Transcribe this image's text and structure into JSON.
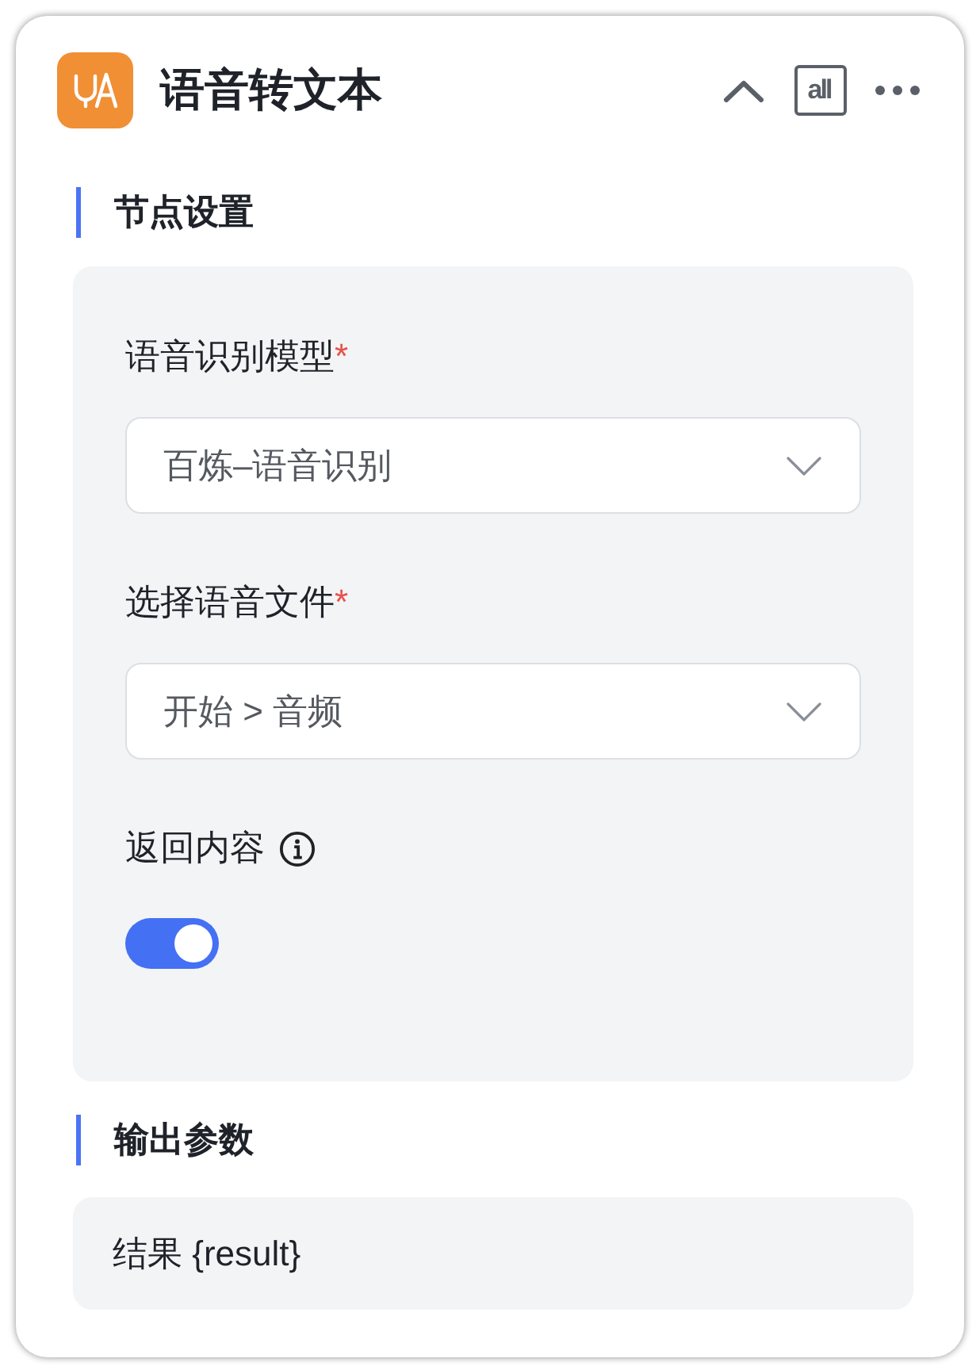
{
  "node": {
    "title": "语音转文本",
    "header_actions": [
      {
        "kind": "collapse"
      },
      {
        "kind": "text",
        "label": "all"
      },
      {
        "kind": "more"
      }
    ]
  },
  "sections": [
    {
      "kind": "settings",
      "title": "节点设置",
      "fields": [
        {
          "kind": "select",
          "label": "语音识别模型",
          "required_mark": "*",
          "value": "百炼–语音识别"
        },
        {
          "kind": "select",
          "label": "选择语音文件",
          "required_mark": "*",
          "value": "开始 > 音频"
        },
        {
          "kind": "switch",
          "label": "返回内容",
          "has_info": true,
          "on": true
        }
      ]
    },
    {
      "kind": "outputs",
      "title": "输出参数",
      "outputs": [
        "结果 {result}"
      ]
    }
  ]
}
